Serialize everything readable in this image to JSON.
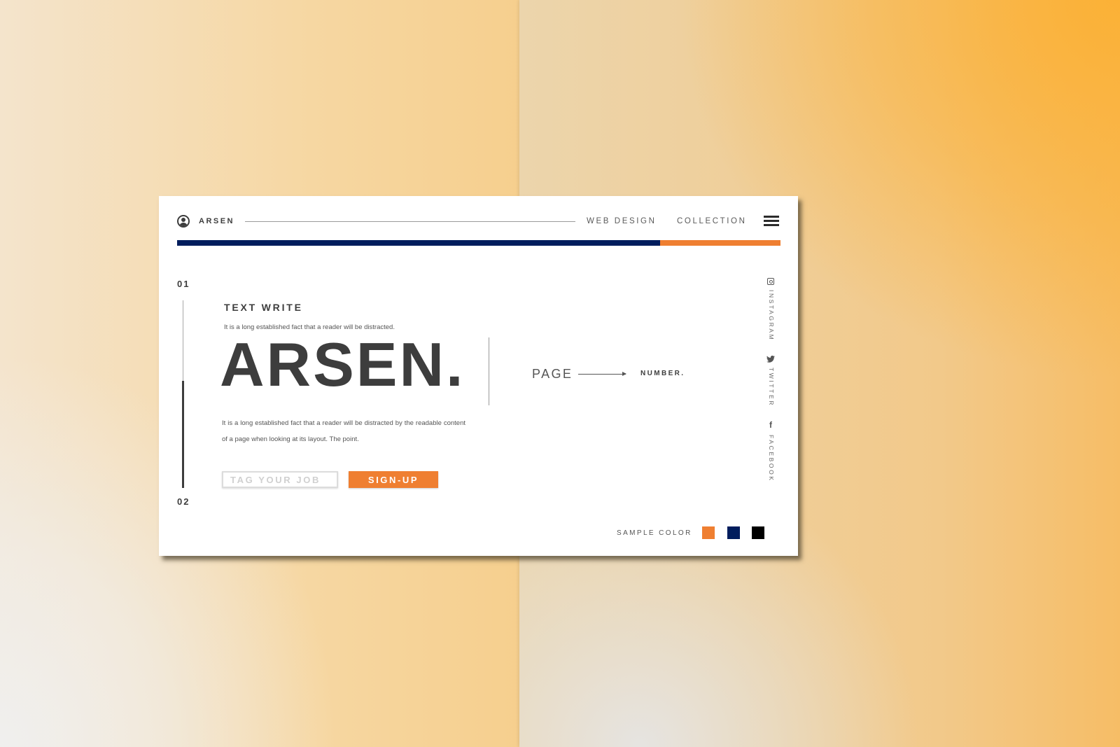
{
  "header": {
    "brand": "ARSEN",
    "nav": [
      "WEB DESIGN",
      "COLLECTION"
    ],
    "progress_fraction": 0.8
  },
  "colors": {
    "accent": "#ef7f31",
    "primary": "#001d5d",
    "dark": "#000000"
  },
  "main": {
    "step_start": "01",
    "step_end": "02",
    "section_title": "TEXT WRITE",
    "subtitle": "It is a long established fact that a reader will be distracted.",
    "hero": "ARSEN.",
    "paragraph": "It is a long established fact that a reader will be distracted by the readable content of a page when looking at its layout. The point.",
    "input_placeholder": "TAG YOUR JOB",
    "signup_label": "SIGN-UP",
    "page_label": "PAGE",
    "number_label": "NUMBER."
  },
  "social": [
    {
      "icon": "instagram-icon",
      "label": "INSTAGRAM"
    },
    {
      "icon": "twitter-icon",
      "label": "TWITTER"
    },
    {
      "icon": "facebook-icon",
      "label": "FACEBOOK"
    }
  ],
  "footer": {
    "sample_label": "SAMPLE COLOR",
    "swatches": [
      "#ef7f31",
      "#001d5d",
      "#000000"
    ]
  }
}
